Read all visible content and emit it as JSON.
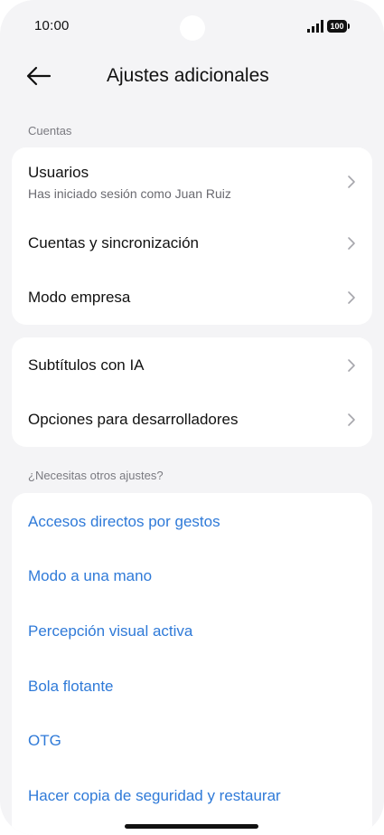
{
  "status": {
    "time": "10:00",
    "battery": "100"
  },
  "header": {
    "title": "Ajustes adicionales"
  },
  "sections": {
    "accounts_label": "Cuentas",
    "other_label": "¿Necesitas otros ajustes?"
  },
  "accounts": {
    "users_title": "Usuarios",
    "users_sub": "Has iniciado sesión como Juan Ruiz",
    "sync": "Cuentas y sincronización",
    "enterprise": "Modo empresa"
  },
  "extras": {
    "subtitles": "Subtítulos con IA",
    "dev_options": "Opciones para desarrolladores"
  },
  "links": [
    "Accesos directos por gestos",
    "Modo a una mano",
    "Percepción visual activa",
    "Bola flotante",
    "OTG",
    "Hacer copia de seguridad y restaurar"
  ],
  "colors": {
    "link": "#2f7ad8",
    "background": "#f4f4f6",
    "card": "#ffffff"
  },
  "icons": {
    "back": "arrow-left-icon",
    "chevron": "chevron-right-icon",
    "signal": "signal-icon",
    "battery": "battery-icon"
  }
}
